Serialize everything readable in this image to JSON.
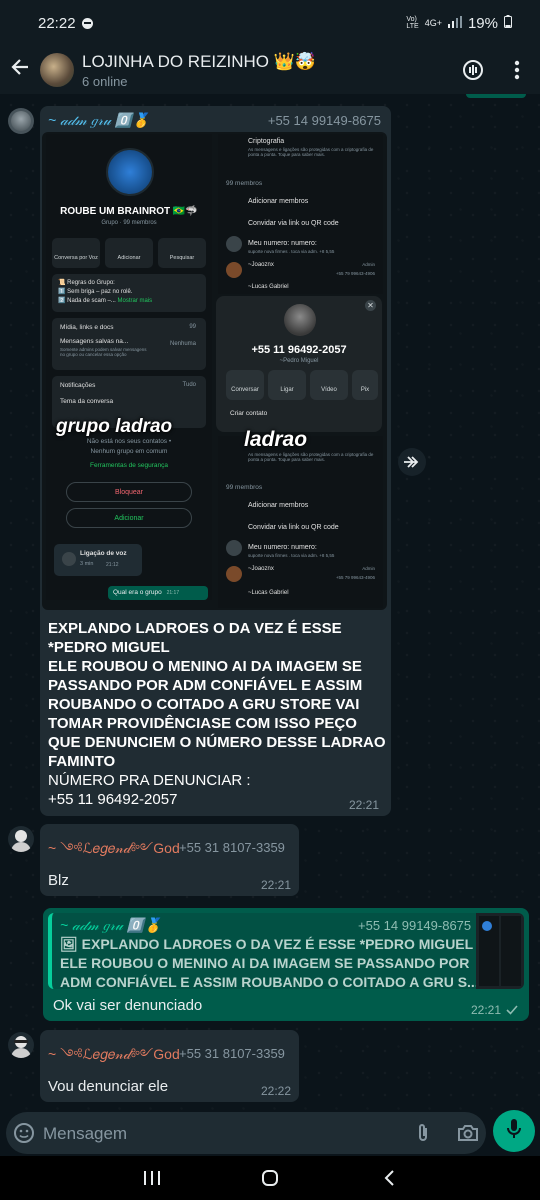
{
  "status_bar": {
    "time": "22:22",
    "network": "4G+",
    "battery": "19%"
  },
  "header": {
    "title": "LOJINHA DO REIZINHO 👑🤯",
    "subtitle": "6 online"
  },
  "messages": [
    {
      "sender": "~ 𝒶𝒹𝓂 𝑔𝓇𝓊 0️⃣🥇",
      "phone": "+55 14 99149-8675",
      "screenshot": {
        "crypto_title": "Criptografia",
        "crypto_desc": "As mensagens e ligações são protegidas com a criptografia de ponta a ponta. Toque para saber mais.",
        "members_header": "99 membros",
        "add_members": "Adicionar membros",
        "invite_link": "Convidar via link ou QR code",
        "my_number": "Meu numero: numero:",
        "my_number_sub": "suporte nova firmes . toca via adm. +8 5,55",
        "member2": "~Joaoznx",
        "member2_phone": "+55 79 99643-4906",
        "admin_label": "Admin",
        "member3": "~Lucas Gabriel",
        "group_name": "ROUBE UM BRAINROT 🇧🇷🦈",
        "group_sub": "Grupo · 99 membros",
        "btn_voice": "Conversa por Voz",
        "btn_add": "Adicionar",
        "btn_search": "Pesquisar",
        "rules_title": "📜 Regras do Grupo:",
        "rule1": "1️⃣ Sem briga – paz no rolê.",
        "rule2": "2️⃣ Nada de scam –...",
        "show_more": "Mostrar mais",
        "media_label": "Mídia, links e docs",
        "media_count": "99",
        "saved_title": "Mensagens salvas na...",
        "saved_desc": "Somente admins podem salvar mensagens no grupo ou cancelar essa opção",
        "saved_value": "Nenhuma",
        "notifications": "Notificações",
        "notifications_value": "Tudo",
        "theme": "Tema da conversa",
        "overlay1": "grupo ladrao",
        "overlay2": "ladrao",
        "not_contacts": "Não está nos seus contatos •",
        "no_common_group": "Nenhum grupo em comum",
        "security_tools": "Ferramentas de segurança",
        "block": "Bloquear",
        "add": "Adicionar",
        "call_title": "Ligação de voz",
        "call_duration": "3 min",
        "call_time": "21:12",
        "sent_msg": "Qual era o grupo",
        "sent_time": "21:17",
        "card_phone": "+55 11 96492-2057",
        "card_name": "~Pedro Miguel",
        "card_chat": "Conversar",
        "card_call": "Ligar",
        "card_video": "Vídeo",
        "card_pix": "Pix",
        "card_create": "Criar contato"
      },
      "lines": [
        "EXPLANDO LADROES O DA VEZ É ESSE",
        "*PEDRO MIGUEL",
        "ELE ROUBOU O MENINO AI DA IMAGEM SE",
        "PASSANDO POR ADM CONFIÁVEL E ASSIM",
        "ROUBANDO O COITADO A GRU STORE VAI",
        "TOMAR PROVIDÊNCIASE COM ISSO PEÇO",
        "QUE DENUNCIEM O NÚMERO DESSE LADRAO",
        "FAMINTO"
      ],
      "report_label": " NÚMERO PRA DENUNCIAR :",
      "report_number": "+55 11 96492-2057",
      "time": "22:21"
    },
    {
      "sender": "~ ༺ℒ𝑒𝑔𝑒𝓃𝒹༻God",
      "phone": "+55 31 8107-3359",
      "text": "Blz",
      "time": "22:21"
    },
    {
      "quote_sender": "~ 𝒶𝒹𝓂 𝑔𝓇𝓊 0️⃣🥇",
      "quote_phone": "+55 14 99149-8675",
      "quote_text": "🖼 EXPLANDO LADROES O DA VEZ É ESSE *PEDRO MIGUEL ELE ROUBOU O MENINO AI DA IMAGEM SE PASSANDO POR ADM CONFIÁVEL E ASSIM ROUBANDO O COITADO A GRU S...",
      "text": "Ok  vai ser denunciado",
      "time": "22:21"
    },
    {
      "sender": "~ ༺ℒ𝑒𝑔𝑒𝓃𝒹༻God",
      "phone": "+55 31 8107-3359",
      "text": "Vou denunciar ele",
      "time": "22:22"
    }
  ],
  "composer": {
    "placeholder": "Mensagem"
  }
}
